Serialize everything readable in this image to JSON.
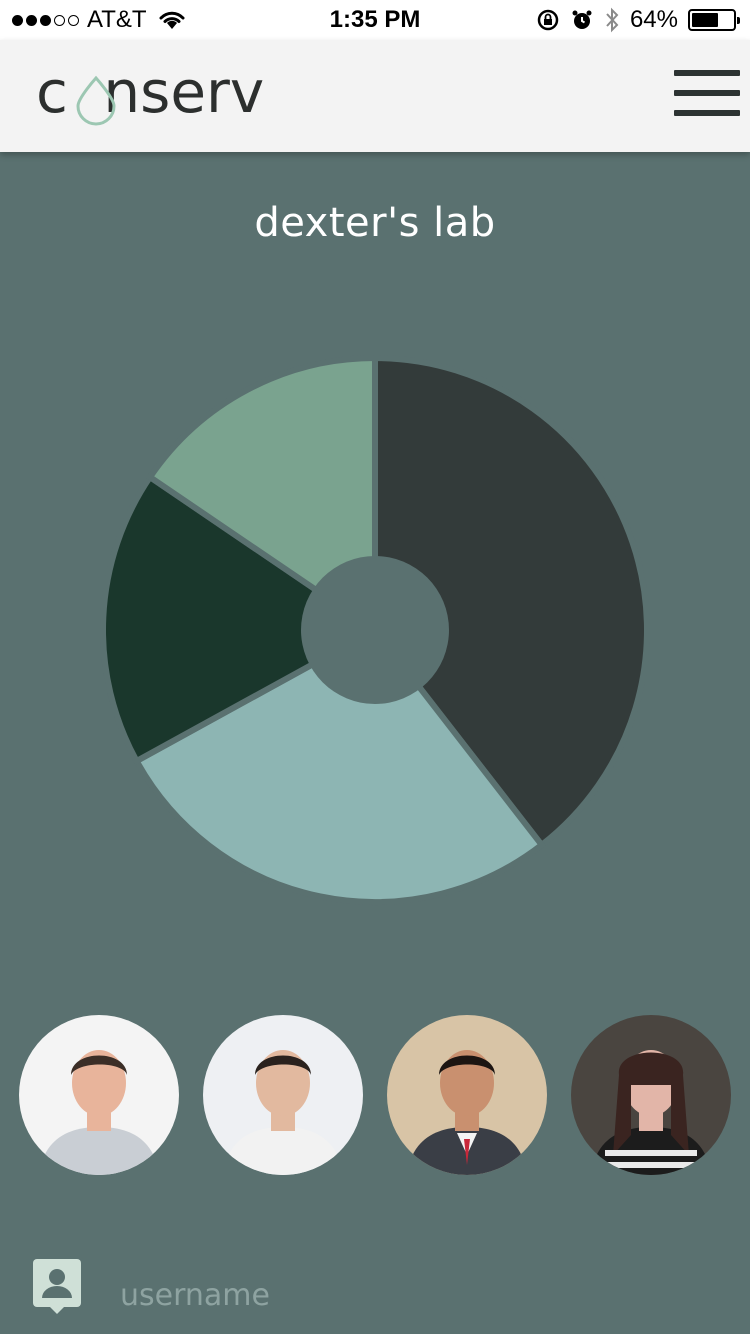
{
  "status_bar": {
    "carrier": "AT&T",
    "signal_bars_filled": 3,
    "signal_bars_total": 5,
    "time": "1:35 PM",
    "battery_percent": "64%",
    "battery_level": 0.64,
    "icons": [
      "wifi-icon",
      "rotation-lock-icon",
      "alarm-icon",
      "bluetooth-icon",
      "battery-icon"
    ]
  },
  "header": {
    "logo_text": "conserv",
    "menu_icon": "hamburger-menu-icon"
  },
  "main": {
    "title": "dexter's lab"
  },
  "chart_data": {
    "type": "pie",
    "donut": true,
    "slices": [
      {
        "value": 39.5,
        "color": "#333b3a"
      },
      {
        "value": 27.5,
        "color": "#8db5b3"
      },
      {
        "value": 17.5,
        "color": "#1a372c"
      },
      {
        "value": 15.5,
        "color": "#7aa38f"
      }
    ],
    "start_angle": "12 o'clock, clockwise",
    "center_color": "#5a7170"
  },
  "avatars": [
    {
      "name": "avatar-man-gray-shirt",
      "bg": "#f4f4f4",
      "skin": "#e8b49b",
      "hair": "#3b2e27",
      "shirt": "#c9ced4"
    },
    {
      "name": "avatar-man-white-shirt",
      "bg": "#eef0f3",
      "skin": "#e2b99f",
      "hair": "#2a221e",
      "shirt": "#f2f2f2"
    },
    {
      "name": "avatar-man-suit",
      "bg": "#d8c4a6",
      "skin": "#c9906f",
      "hair": "#1c1512",
      "shirt": "#3a3e46"
    },
    {
      "name": "avatar-woman",
      "bg": "#4a4540",
      "skin": "#e2b5a8",
      "hair": "#3a2420",
      "shirt": "#1c1c1c"
    }
  ],
  "footer": {
    "username": "username",
    "user_icon": "user-badge-icon"
  },
  "colors": {
    "background": "#5a7170",
    "header_bg": "#f3f3f3",
    "logo_drop": "#9cc7b2"
  }
}
